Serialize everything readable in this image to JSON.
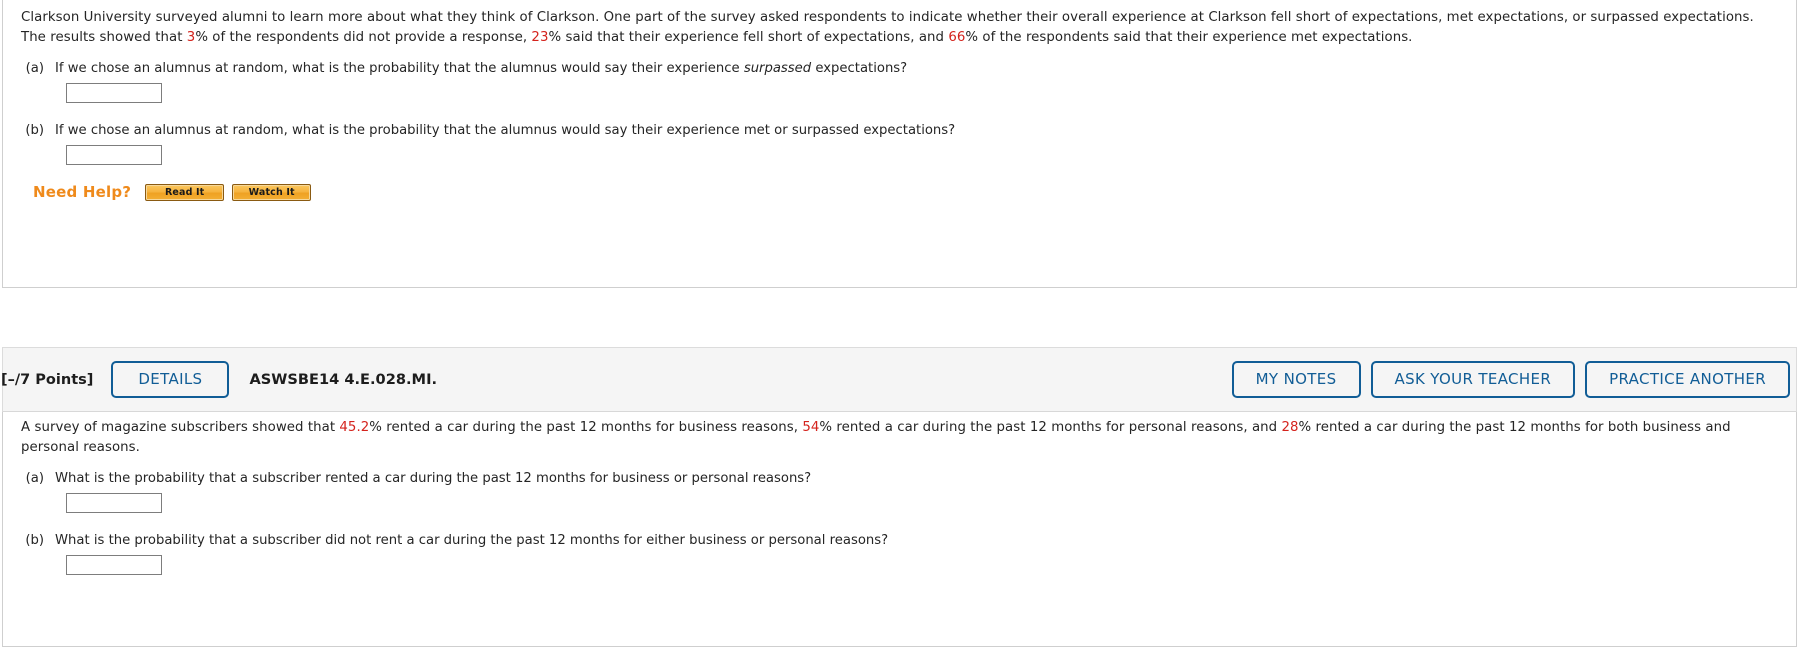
{
  "problem1": {
    "prompt_parts": [
      {
        "t": "Clarkson University surveyed alumni to learn more about what they think of Clarkson. One part of the survey asked respondents to indicate whether their overall experience at Clarkson fell short of expectations, met expectations, or surpassed expectations. The results showed that ",
        "c": "plain"
      },
      {
        "t": "3",
        "c": "red"
      },
      {
        "t": "% of the respondents did not provide a response, ",
        "c": "plain"
      },
      {
        "t": "23",
        "c": "red"
      },
      {
        "t": "% said that their experience fell short of expectations, and ",
        "c": "plain"
      },
      {
        "t": "66",
        "c": "red"
      },
      {
        "t": "% of the respondents said that their experience met expectations.",
        "c": "plain"
      }
    ],
    "questions": [
      {
        "label": "(a)",
        "text_before": "If we chose an alumnus at random, what is the probability that the alumnus would say their experience ",
        "text_italic": "surpassed",
        "text_after": " expectations?",
        "answer_value": ""
      },
      {
        "label": "(b)",
        "text_before": "If we chose an alumnus at random, what is the probability that the alumnus would say their experience met or surpassed expectations?",
        "text_italic": "",
        "text_after": "",
        "answer_value": ""
      }
    ],
    "need_help": {
      "label": "Need Help?",
      "buttons": [
        {
          "label": "Read It",
          "name": "read-it-button"
        },
        {
          "label": "Watch It",
          "name": "watch-it-button"
        }
      ]
    }
  },
  "problem2": {
    "header": {
      "points": "[–/7 Points]",
      "details_label": "DETAILS",
      "question_id": "ASWSBE14 4.E.028.MI.",
      "actions": [
        {
          "label": "MY NOTES",
          "name": "my-notes-button"
        },
        {
          "label": "ASK YOUR TEACHER",
          "name": "ask-your-teacher-button"
        },
        {
          "label": "PRACTICE ANOTHER",
          "name": "practice-another-button"
        }
      ]
    },
    "prompt_parts": [
      {
        "t": "A survey of magazine subscribers showed that ",
        "c": "plain"
      },
      {
        "t": "45.2",
        "c": "red"
      },
      {
        "t": "% rented a car during the past 12 months for business reasons, ",
        "c": "plain"
      },
      {
        "t": "54",
        "c": "red"
      },
      {
        "t": "% rented a car during the past 12 months for personal reasons, and ",
        "c": "plain"
      },
      {
        "t": "28",
        "c": "red"
      },
      {
        "t": "% rented a car during the past 12 months for both business and personal reasons.",
        "c": "plain"
      }
    ],
    "questions": [
      {
        "label": "(a)",
        "text_before": "What is the probability that a subscriber rented a car during the past 12 months for business or personal reasons?",
        "text_italic": "",
        "text_after": "",
        "answer_value": ""
      },
      {
        "label": "(b)",
        "text_before": "What is the probability that a subscriber did not rent a car during the past 12 months for either business or personal reasons?",
        "text_italic": "",
        "text_after": "",
        "answer_value": ""
      }
    ]
  },
  "colors": {
    "accent_blue": "#115d96",
    "value_red": "#d4231d",
    "need_help_orange": "#ef8a1b"
  }
}
